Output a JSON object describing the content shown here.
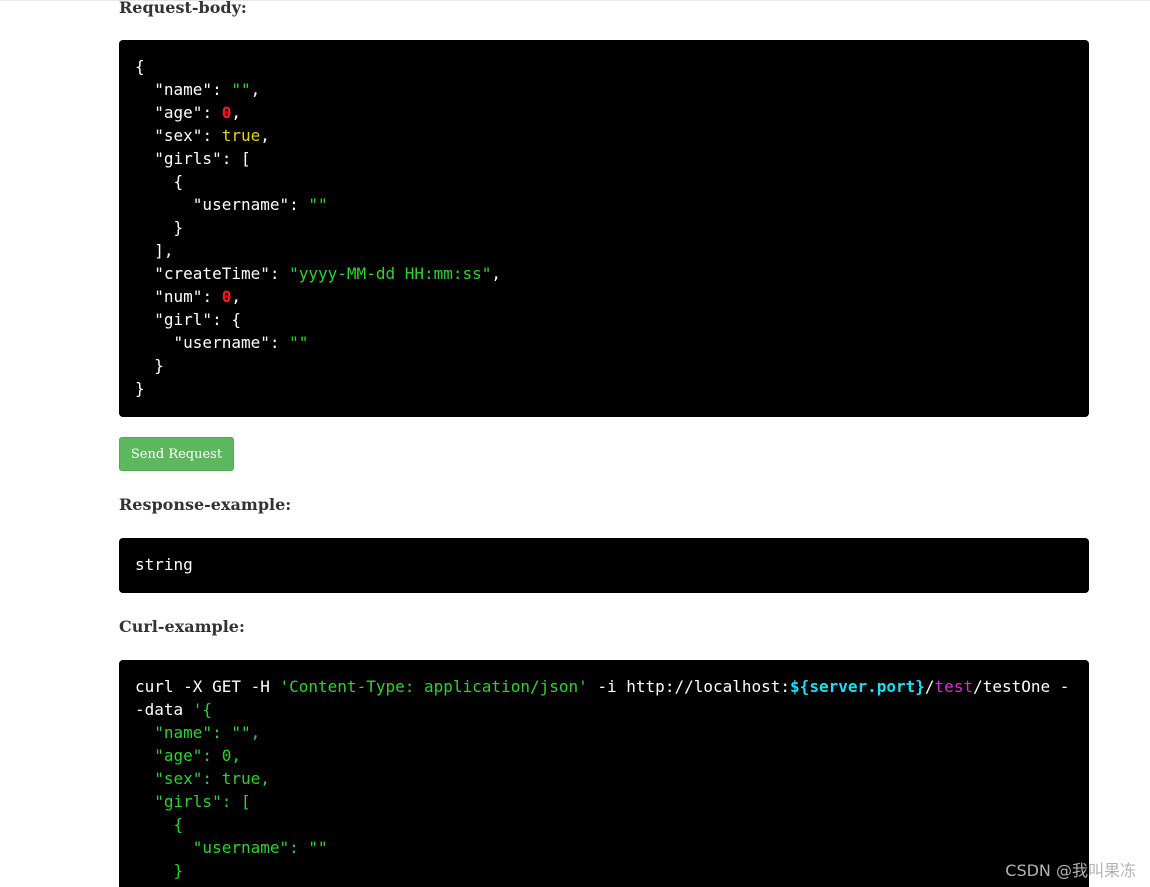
{
  "sections": {
    "request_body": {
      "heading": "Request-body:",
      "lines": [
        [
          {
            "t": "{",
            "c": "punc"
          }
        ],
        [
          {
            "t": "  ",
            "c": "punc"
          },
          {
            "t": "\"name\"",
            "c": "key"
          },
          {
            "t": ": ",
            "c": "punc"
          },
          {
            "t": "\"\"",
            "c": "str"
          },
          {
            "t": ",",
            "c": "punc"
          }
        ],
        [
          {
            "t": "  ",
            "c": "punc"
          },
          {
            "t": "\"age\"",
            "c": "key"
          },
          {
            "t": ": ",
            "c": "punc"
          },
          {
            "t": "0",
            "c": "num"
          },
          {
            "t": ",",
            "c": "punc"
          }
        ],
        [
          {
            "t": "  ",
            "c": "punc"
          },
          {
            "t": "\"sex\"",
            "c": "key"
          },
          {
            "t": ": ",
            "c": "punc"
          },
          {
            "t": "true",
            "c": "bool"
          },
          {
            "t": ",",
            "c": "punc"
          }
        ],
        [
          {
            "t": "  ",
            "c": "punc"
          },
          {
            "t": "\"girls\"",
            "c": "key"
          },
          {
            "t": ": [",
            "c": "punc"
          }
        ],
        [
          {
            "t": "    {",
            "c": "punc"
          }
        ],
        [
          {
            "t": "      ",
            "c": "punc"
          },
          {
            "t": "\"username\"",
            "c": "key"
          },
          {
            "t": ": ",
            "c": "punc"
          },
          {
            "t": "\"\"",
            "c": "str"
          }
        ],
        [
          {
            "t": "    }",
            "c": "punc"
          }
        ],
        [
          {
            "t": "  ],",
            "c": "punc"
          }
        ],
        [
          {
            "t": "  ",
            "c": "punc"
          },
          {
            "t": "\"createTime\"",
            "c": "key"
          },
          {
            "t": ": ",
            "c": "punc"
          },
          {
            "t": "\"yyyy-MM-dd HH:mm:ss\"",
            "c": "str"
          },
          {
            "t": ",",
            "c": "punc"
          }
        ],
        [
          {
            "t": "  ",
            "c": "punc"
          },
          {
            "t": "\"num\"",
            "c": "key"
          },
          {
            "t": ": ",
            "c": "punc"
          },
          {
            "t": "0",
            "c": "num"
          },
          {
            "t": ",",
            "c": "punc"
          }
        ],
        [
          {
            "t": "  ",
            "c": "punc"
          },
          {
            "t": "\"girl\"",
            "c": "key"
          },
          {
            "t": ": {",
            "c": "punc"
          }
        ],
        [
          {
            "t": "    ",
            "c": "punc"
          },
          {
            "t": "\"username\"",
            "c": "key"
          },
          {
            "t": ": ",
            "c": "punc"
          },
          {
            "t": "\"\"",
            "c": "str"
          }
        ],
        [
          {
            "t": "  }",
            "c": "punc"
          }
        ],
        [
          {
            "t": "}",
            "c": "punc"
          }
        ]
      ]
    },
    "send_button_label": "Send Request",
    "response_example": {
      "heading": "Response-example:",
      "lines": [
        [
          {
            "t": "string",
            "c": "plain"
          }
        ]
      ]
    },
    "curl_example": {
      "heading": "Curl-example:",
      "lines": [
        [
          {
            "t": "curl -X GET -H ",
            "c": "plain"
          },
          {
            "t": "'Content-Type: application/json'",
            "c": "green"
          },
          {
            "t": " -i http://localhost:",
            "c": "plain"
          },
          {
            "t": "${server.port}",
            "c": "cyan"
          },
          {
            "t": "/",
            "c": "plain"
          },
          {
            "t": "test",
            "c": "magenta"
          },
          {
            "t": "/testOne -",
            "c": "plain"
          }
        ],
        [
          {
            "t": "-data ",
            "c": "plain"
          },
          {
            "t": "'{",
            "c": "green"
          }
        ],
        [
          {
            "t": "  \"name\": \"\",",
            "c": "green"
          }
        ],
        [
          {
            "t": "  \"age\": 0,",
            "c": "green"
          }
        ],
        [
          {
            "t": "  \"sex\": true,",
            "c": "green"
          }
        ],
        [
          {
            "t": "  \"girls\": [",
            "c": "green"
          }
        ],
        [
          {
            "t": "    {",
            "c": "green"
          }
        ],
        [
          {
            "t": "      \"username\": \"\"",
            "c": "green"
          }
        ],
        [
          {
            "t": "    }",
            "c": "green"
          }
        ]
      ]
    }
  },
  "watermark": "CSDN @我叫果冻",
  "colors": {
    "code_background": "#000000",
    "string": "#2cd32c",
    "number": "#ff1a1a",
    "boolean": "#e6d31c",
    "cyan_var": "#19e0f0",
    "magenta": "#e02ad8",
    "button": "#5cb85c"
  }
}
